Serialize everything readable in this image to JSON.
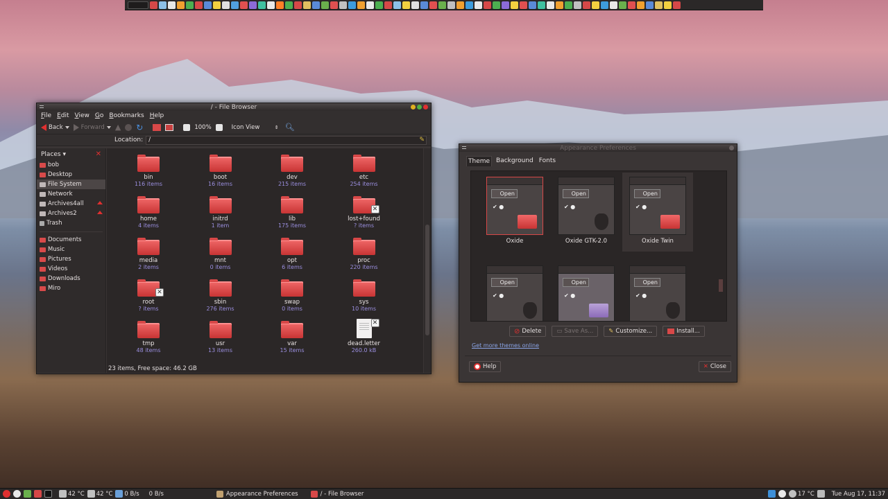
{
  "top_panel": {
    "icons": [
      "#d64848",
      "#8cc0e8",
      "#e7e7e7",
      "#f0a030",
      "#4caf50",
      "#d64848",
      "#5a8ad8",
      "#f2d040",
      "#e0e0e0",
      "#50a0e0",
      "#e05050",
      "#8c6bd8",
      "#40c0a0",
      "#e8e8e8",
      "#ff7f27",
      "#4caf50",
      "#d64848",
      "#e0c060",
      "#5a8ad8",
      "#6ab04c",
      "#e05050",
      "#c0c0c0",
      "#3d9cdd",
      "#f0a030",
      "#e8e8e8",
      "#4caf50",
      "#d64848",
      "#8cc0e8",
      "#f2d040",
      "#e0e0e0",
      "#5a8ad8",
      "#e05050",
      "#6ab04c",
      "#c0c0c0",
      "#f0a030",
      "#3d9cdd",
      "#e8e8e8",
      "#d64848",
      "#4caf50",
      "#8c6bd8",
      "#f2d040",
      "#e05050",
      "#5a8ad8",
      "#40c0a0",
      "#e8e8e8",
      "#f0a030",
      "#4caf50",
      "#c0c0c0",
      "#d64848",
      "#f2d040",
      "#3d9cdd",
      "#e8e8e8",
      "#6ab04c",
      "#e05050",
      "#f0a030",
      "#5a8ad8",
      "#e0c060",
      "#f2d040",
      "#d64848"
    ]
  },
  "file_browser": {
    "title": "/ - File Browser",
    "menus": [
      "File",
      "Edit",
      "View",
      "Go",
      "Bookmarks",
      "Help"
    ],
    "toolbar": {
      "back": "Back",
      "forward": "Forward",
      "zoom": "100%",
      "view_mode": "Icon View"
    },
    "location_label": "Location:",
    "location_value": "/",
    "places_label": "Places",
    "places": [
      {
        "label": "bob",
        "icon": "folder-icon"
      },
      {
        "label": "Desktop",
        "icon": "folder-icon"
      },
      {
        "label": "File System",
        "icon": "drive-icon",
        "selected": true
      },
      {
        "label": "Network",
        "icon": "network-icon"
      },
      {
        "label": "Archives4all",
        "icon": "drive-icon",
        "eject": true
      },
      {
        "label": "Archives2",
        "icon": "drive-icon",
        "eject": true
      },
      {
        "label": "Trash",
        "icon": "trash-icon"
      }
    ],
    "bookmarks": [
      {
        "label": "Documents"
      },
      {
        "label": "Music"
      },
      {
        "label": "Pictures"
      },
      {
        "label": "Videos"
      },
      {
        "label": "Downloads"
      },
      {
        "label": "Miro"
      }
    ],
    "items": [
      {
        "name": "bin",
        "count": "116 items"
      },
      {
        "name": "boot",
        "count": "16 items"
      },
      {
        "name": "dev",
        "count": "215 items"
      },
      {
        "name": "etc",
        "count": "254 items"
      },
      {
        "name": "home",
        "count": "4 items"
      },
      {
        "name": "initrd",
        "count": "1 item"
      },
      {
        "name": "lib",
        "count": "175 items"
      },
      {
        "name": "lost+found",
        "count": "? items",
        "locked": true
      },
      {
        "name": "media",
        "count": "2 items"
      },
      {
        "name": "mnt",
        "count": "0 items"
      },
      {
        "name": "opt",
        "count": "6 items"
      },
      {
        "name": "proc",
        "count": "220 items"
      },
      {
        "name": "root",
        "count": "? items",
        "locked": true
      },
      {
        "name": "sbin",
        "count": "276 items"
      },
      {
        "name": "swap",
        "count": "0 items"
      },
      {
        "name": "sys",
        "count": "10 items"
      },
      {
        "name": "tmp",
        "count": "48 items"
      },
      {
        "name": "usr",
        "count": "13 items"
      },
      {
        "name": "var",
        "count": "15 items"
      },
      {
        "name": "dead.letter",
        "count": "260.0 kB",
        "file": true,
        "locked": true
      }
    ],
    "status": "23 items, Free space: 46.2 GB"
  },
  "appearance": {
    "title": "Appearance Preferences",
    "tabs": [
      "Theme",
      "Background",
      "Fonts"
    ],
    "open_label": "Open",
    "themes": [
      {
        "name": "Oxide",
        "style": "oxide"
      },
      {
        "name": "Oxide GTK-2.0",
        "style": "gnome"
      },
      {
        "name": "Oxide Twin",
        "style": "twin",
        "selected": true
      },
      {
        "name": "",
        "style": "gnome"
      },
      {
        "name": "",
        "style": "purple"
      },
      {
        "name": "",
        "style": "gnome"
      }
    ],
    "buttons": {
      "delete": "Delete",
      "save_as": "Save As...",
      "customize": "Customize...",
      "install": "Install..."
    },
    "more_link": "Get more themes online",
    "help": "Help",
    "close": "Close"
  },
  "bottom_panel": {
    "temp1": "42 °C",
    "temp2": "42 °C",
    "net1": "0 B/s",
    "net2": "0 B/s",
    "tasks": [
      "Appearance Preferences",
      "/ - File Browser"
    ],
    "weather": "17 °C",
    "clock": "Tue Aug 17, 11:37"
  }
}
